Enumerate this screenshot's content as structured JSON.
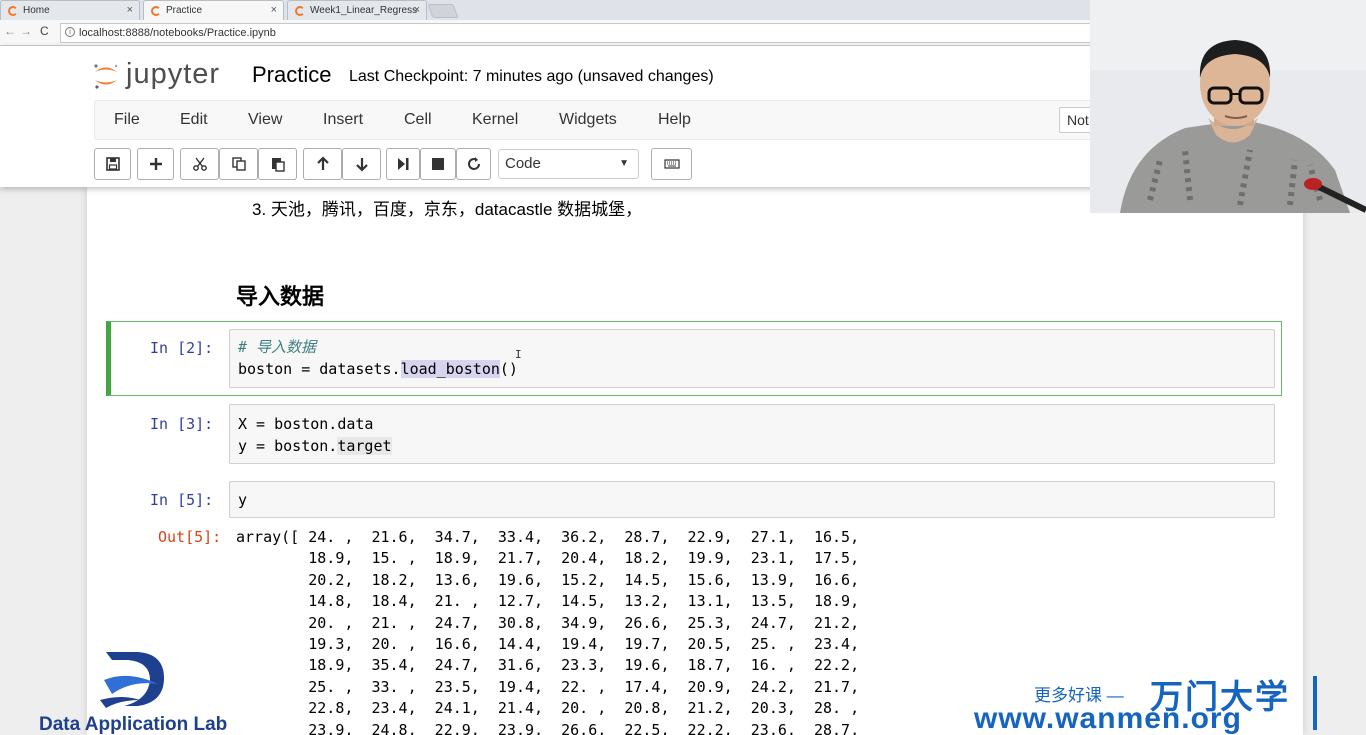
{
  "browser": {
    "tabs": [
      {
        "label": "Home",
        "active": false
      },
      {
        "label": "Practice",
        "active": true
      },
      {
        "label": "Week1_Linear_Regress",
        "active": false
      }
    ],
    "close_glyph": "×",
    "url": "localhost:8888/notebooks/Practice.ipynb"
  },
  "jupyter": {
    "logo_text": "jupyter",
    "notebook_title": "Practice",
    "checkpoint": "Last Checkpoint: 7 minutes ago (unsaved changes)",
    "menu": [
      "File",
      "Edit",
      "View",
      "Insert",
      "Cell",
      "Kernel",
      "Widgets",
      "Help"
    ],
    "kernel_indicator": "Not",
    "cell_type": "Code",
    "toolbar_icons": [
      "save-icon",
      "plus-icon",
      "cut-icon",
      "copy-icon",
      "paste-icon",
      "arrow-up-icon",
      "arrow-down-icon",
      "run-icon",
      "stop-icon",
      "restart-icon",
      "keyboard-icon"
    ]
  },
  "notebook": {
    "markdown_item": "3. 天池，腾讯，百度，京东，datacastle 数据城堡，",
    "markdown_heading": "导入数据",
    "cells": [
      {
        "prompt": "In  [2]:",
        "line1_comment": "# 导入数据",
        "line2_pre": "boston = datasets.",
        "line2_hl": "load_boston",
        "line2_post": "()"
      },
      {
        "prompt": "In  [3]:",
        "line1": "X = boston.data",
        "line2_pre": "y = boston.",
        "line2_hl": "target"
      },
      {
        "prompt": "In  [5]:",
        "line1": "y"
      }
    ],
    "output_prompt": "Out[5]:",
    "output_text": "array([ 24. ,  21.6,  34.7,  33.4,  36.2,  28.7,  22.9,  27.1,  16.5,\n        18.9,  15. ,  18.9,  21.7,  20.4,  18.2,  19.9,  23.1,  17.5,\n        20.2,  18.2,  13.6,  19.6,  15.2,  14.5,  15.6,  13.9,  16.6,\n        14.8,  18.4,  21. ,  12.7,  14.5,  13.2,  13.1,  13.5,  18.9,\n        20. ,  21. ,  24.7,  30.8,  34.9,  26.6,  25.3,  24.7,  21.2,\n        19.3,  20. ,  16.6,  14.4,  19.4,  19.7,  20.5,  25. ,  23.4,\n        18.9,  35.4,  24.7,  31.6,  23.3,  19.6,  18.7,  16. ,  22.2,\n        25. ,  33. ,  23.5,  19.4,  22. ,  17.4,  20.9,  24.2,  21.7,\n        22.8,  23.4,  24.1,  21.4,  20. ,  20.8,  21.2,  20.3,  28. ,\n        23.9,  24.8,  22.9,  23.9,  26.6,  22.5,  22.2,  23.6,  28.7,"
  },
  "watermark": {
    "lab_name": "Data Application Lab",
    "tagline": "更多好课 —",
    "brand": "万门大学",
    "url": "www.wanmen.org"
  },
  "colors": {
    "jupyter_orange": "#f37726",
    "prompt_in": "#303f9f",
    "prompt_out": "#d84315",
    "selected_cell": "#42a642",
    "watermark_blue": "#1565c0"
  }
}
